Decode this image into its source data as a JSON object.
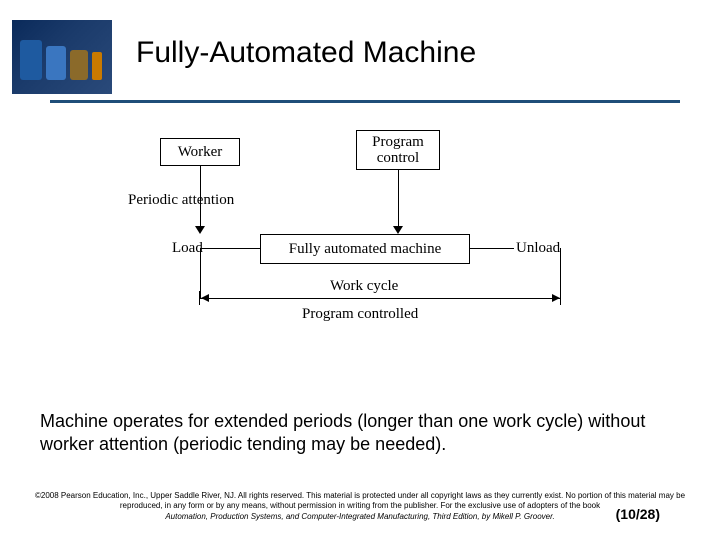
{
  "title": "Fully-Automated Machine",
  "diagram": {
    "worker": "Worker",
    "program_control": "Program\ncontrol",
    "periodic_attention": "Periodic attention",
    "load": "Load",
    "machine": "Fully automated machine",
    "unload": "Unload",
    "work_cycle": "Work cycle",
    "program_controlled": "Program controlled"
  },
  "description": "Machine operates for extended periods (longer than one work cycle) without worker attention (periodic tending may be needed).",
  "footer": {
    "copyright": "©2008 Pearson Education, Inc., Upper Saddle River, NJ. All rights reserved. This material is protected under all copyright laws as they currently exist. No portion of this material may be reproduced, in any form or by any means, without permission in writing from the publisher. For the exclusive use of adopters of the book",
    "book": "Automation, Production Systems, and Computer-Integrated Manufacturing, Third Edition, by Mikell P. Groover."
  },
  "page": "(10/28)"
}
